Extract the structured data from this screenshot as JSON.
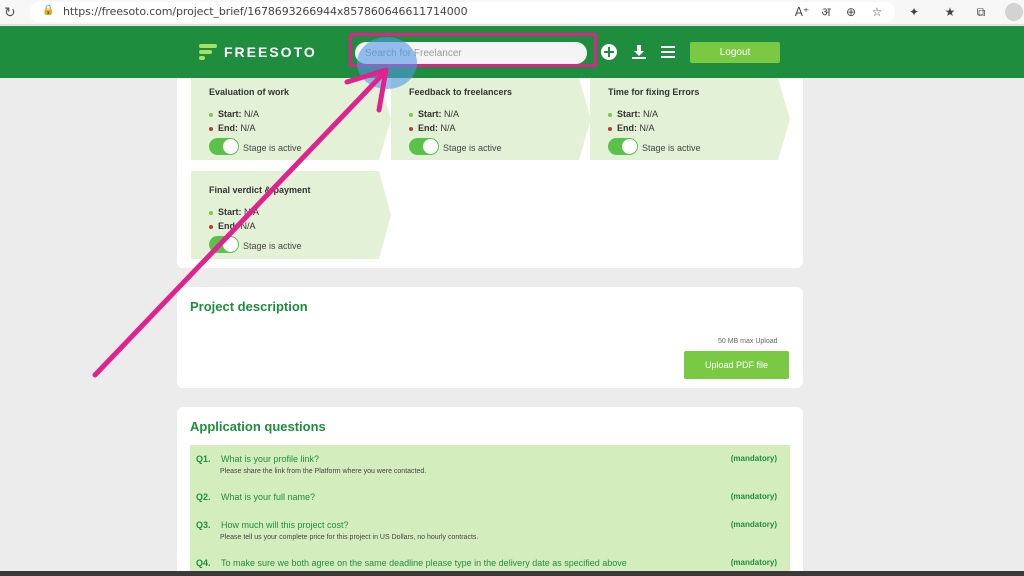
{
  "browser": {
    "url": "https://freesoto.com/project_brief/1678693266944x857860646611714000",
    "icons": [
      "reload-icon",
      "lock-icon",
      "read-aloud-icon",
      "translate-icon",
      "zoom-icon",
      "favorite-icon",
      "extensions-icon",
      "favorites-bar-icon",
      "collections-icon",
      "profile-icon"
    ]
  },
  "header": {
    "logo_text": "FREESOTO",
    "search_placeholder": "Search for Freelancer",
    "logout_label": "Logout",
    "brand_color": "#1e8e3e",
    "accent_color": "#7ac943"
  },
  "stages": [
    {
      "title": "Evaluation of work",
      "start_label": "Start:",
      "start_value": "N/A",
      "end_label": "End:",
      "end_value": "N/A",
      "status": "Stage is active",
      "active": true
    },
    {
      "title": "Feedback to freelancers",
      "start_label": "Start:",
      "start_value": "N/A",
      "end_label": "End:",
      "end_value": "N/A",
      "status": "Stage is active",
      "active": true
    },
    {
      "title": "Time for fixing Errors",
      "start_label": "Start:",
      "start_value": "N/A",
      "end_label": "End:",
      "end_value": "N/A",
      "status": "Stage is active",
      "active": true
    },
    {
      "title": "Final verdict & payment",
      "start_label": "Start:",
      "start_value": "N/A",
      "end_label": "End:",
      "end_value": "N/A",
      "status": "Stage is active",
      "active": true
    }
  ],
  "description": {
    "title": "Project description",
    "upload_hint": "50 MB max Upload",
    "upload_label": "Upload PDF file"
  },
  "questions": {
    "title": "Application questions",
    "items": [
      {
        "num": "Q1.",
        "text": "What is your profile link?",
        "sub": "Please share the link from the Platform where you were contacted.",
        "tag": "(mandatory)"
      },
      {
        "num": "Q2.",
        "text": "What is your full name?",
        "sub": "",
        "tag": "(mandatory)"
      },
      {
        "num": "Q3.",
        "text": "How much will this project cost?",
        "sub": "Please tell us your complete price for this project in US Dollars, no hourly contracts.",
        "tag": "(mandatory)"
      },
      {
        "num": "Q4.",
        "text": "To make sure we both agree on the same deadline please type in the delivery date as specified above",
        "sub": "",
        "tag": "(mandatory)"
      }
    ]
  }
}
